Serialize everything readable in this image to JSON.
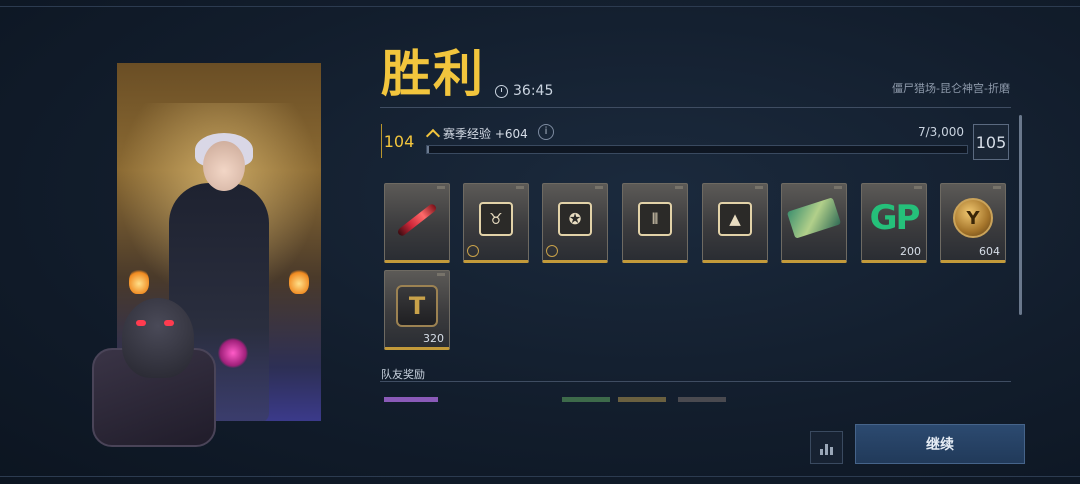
{
  "header": {
    "title": "胜利",
    "time": "36:45",
    "mode": "僵尸猎场-昆仑神宫-折磨"
  },
  "level": {
    "current": "104",
    "next": "105",
    "xp_label": "赛季经验 +604",
    "xp_count": "7/3,000",
    "xp_progress": 0.0023
  },
  "rewards": [
    {
      "name": "weapon-skin-blade",
      "count": ""
    },
    {
      "name": "bull-emblem",
      "count": ""
    },
    {
      "name": "aim-emblem",
      "count": ""
    },
    {
      "name": "ammo-card",
      "count": ""
    },
    {
      "name": "tent-emblem",
      "count": ""
    },
    {
      "name": "rifle-skin",
      "count": ""
    },
    {
      "name": "gp-currency",
      "count": "200",
      "icon_text": "GP"
    },
    {
      "name": "season-coin",
      "count": "604"
    },
    {
      "name": "tt-token",
      "count": "320"
    }
  ],
  "team": {
    "label": "队友奖励"
  },
  "actions": {
    "continue_label": "继续"
  },
  "colors": {
    "gold": "#f2c53d",
    "gp_green": "#25c07a",
    "button": "#2c4a70"
  }
}
